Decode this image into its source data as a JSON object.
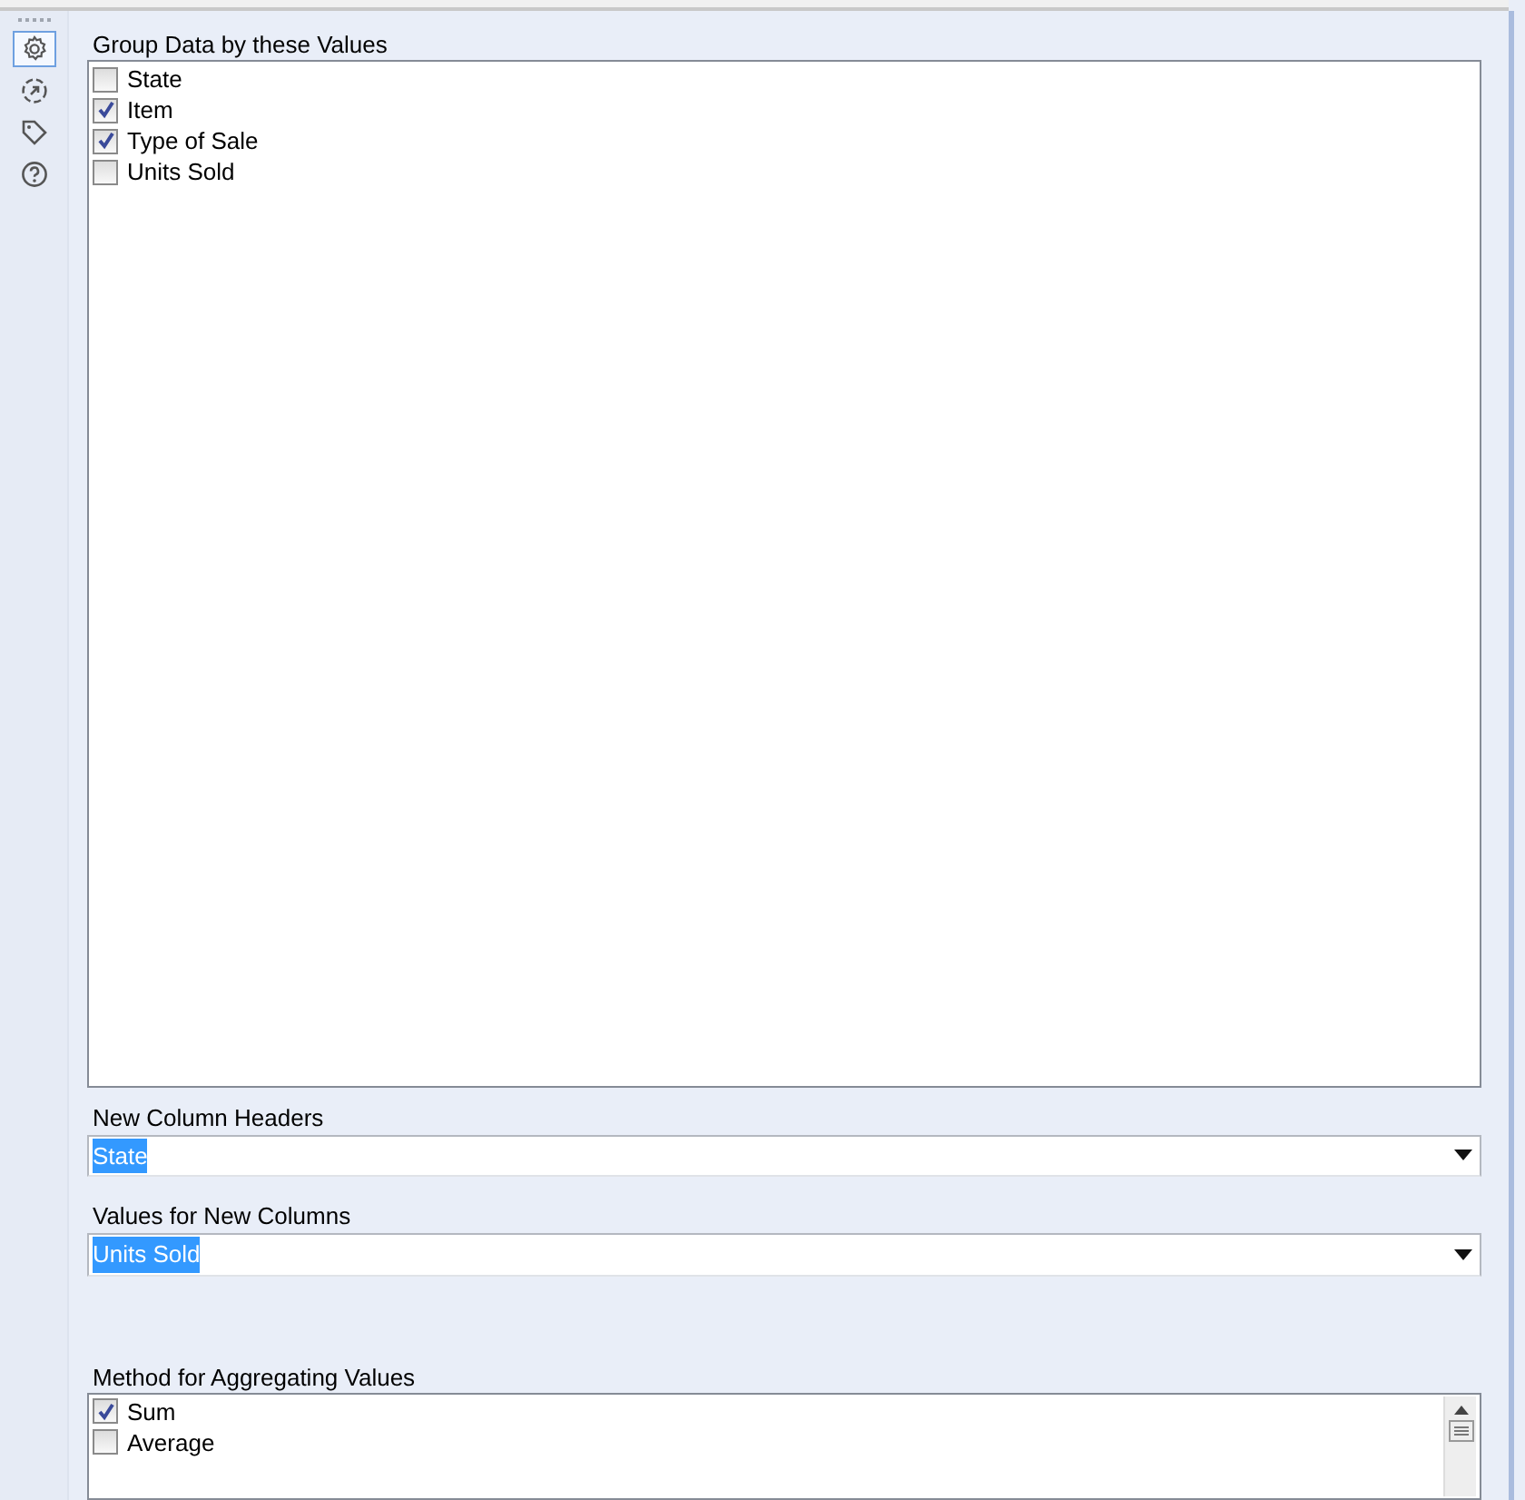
{
  "sidebar": {
    "tools": [
      {
        "kind": "gear",
        "selected": true
      },
      {
        "kind": "arrow",
        "selected": false
      },
      {
        "kind": "tag",
        "selected": false
      },
      {
        "kind": "help",
        "selected": false
      }
    ]
  },
  "group_by": {
    "label": "Group Data by these Values",
    "items": [
      {
        "label": "State",
        "checked": false
      },
      {
        "label": "Item",
        "checked": true
      },
      {
        "label": "Type of Sale",
        "checked": true
      },
      {
        "label": "Units Sold",
        "checked": false
      }
    ]
  },
  "new_column_headers": {
    "label": "New Column Headers",
    "value": "State",
    "text_selected": true
  },
  "values_for_new_columns": {
    "label": "Values for New Columns",
    "value": "Units Sold",
    "text_selected": true
  },
  "aggregation": {
    "label": "Method for Aggregating Values",
    "items": [
      {
        "label": "Sum",
        "checked": true
      },
      {
        "label": "Average",
        "checked": false
      }
    ]
  }
}
